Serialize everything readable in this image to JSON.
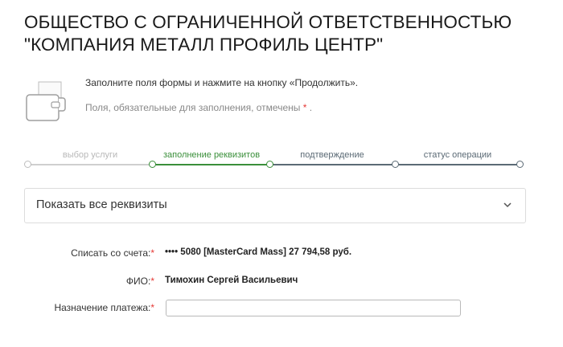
{
  "title": "ОБЩЕСТВО С ОГРАНИЧЕННОЙ ОТВЕТСТВЕННОСТЬЮ \"КОМПАНИЯ МЕТАЛЛ ПРОФИЛЬ ЦЕНТР\"",
  "info": {
    "instruction": "Заполните поля формы и нажмите на кнопку «Продолжить».",
    "required_note": "Поля, обязательные для заполнения, отмечены",
    "required_star": "*",
    "required_end": "."
  },
  "steps": [
    {
      "label": "выбор услуги",
      "state": "done"
    },
    {
      "label": "заполнение реквизитов",
      "state": "active"
    },
    {
      "label": "подтверждение",
      "state": "todo"
    },
    {
      "label": "статус операции",
      "state": "todo"
    }
  ],
  "colors": {
    "step_done": "#cfcfcf",
    "step_active": "#3a8f3a",
    "step_todo": "#5b6a75",
    "required": "#e53935"
  },
  "accordion": {
    "label": "Показать все реквизиты",
    "icon": "chevron-down-icon"
  },
  "form": {
    "account": {
      "label": "Списать со счета:",
      "star": "*",
      "value": "•••• 5080  [MasterCard Mass] 27 794,58   руб."
    },
    "fio": {
      "label": "ФИО:",
      "star": "*",
      "value": "Тимохин Сергей Васильевич"
    },
    "purpose": {
      "label": "Назначение платежа:",
      "star": "*",
      "value": ""
    }
  }
}
